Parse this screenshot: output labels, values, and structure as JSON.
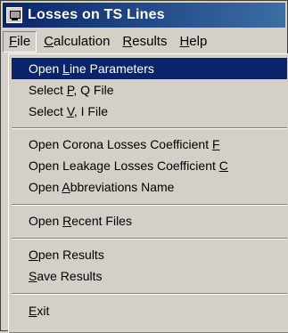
{
  "window": {
    "title": "Losses on TS Lines",
    "icon": "app-window-icon"
  },
  "menubar": {
    "items": [
      {
        "pre": "",
        "key": "F",
        "post": "ile"
      },
      {
        "pre": "",
        "key": "C",
        "post": "alculation"
      },
      {
        "pre": "",
        "key": "R",
        "post": "esults"
      },
      {
        "pre": "",
        "key": "H",
        "post": "elp"
      }
    ]
  },
  "file_menu": {
    "items": [
      {
        "pre": "Open ",
        "key": "L",
        "post": "ine Parameters",
        "highlighted": true
      },
      {
        "pre": "Select ",
        "key": "P",
        "post": ", Q File"
      },
      {
        "pre": "Select ",
        "key": "V",
        "post": ", I File"
      },
      {
        "pre": "Open Corona Losses Coefficient ",
        "key": "F",
        "post": ""
      },
      {
        "pre": "Open Leakage Losses Coefficient ",
        "key": "C",
        "post": ""
      },
      {
        "pre": "Open ",
        "key": "A",
        "post": "bbreviations Name"
      },
      {
        "pre": "Open ",
        "key": "R",
        "post": "ecent Files"
      },
      {
        "pre": "",
        "key": "O",
        "post": "pen Results"
      },
      {
        "pre": "",
        "key": "S",
        "post": "ave Results"
      },
      {
        "pre": "",
        "key": "E",
        "post": "xit"
      }
    ]
  },
  "colors": {
    "highlight": "#0a246a",
    "title_gradient_end": "#3a6ea5",
    "face": "#d4d0c8"
  }
}
